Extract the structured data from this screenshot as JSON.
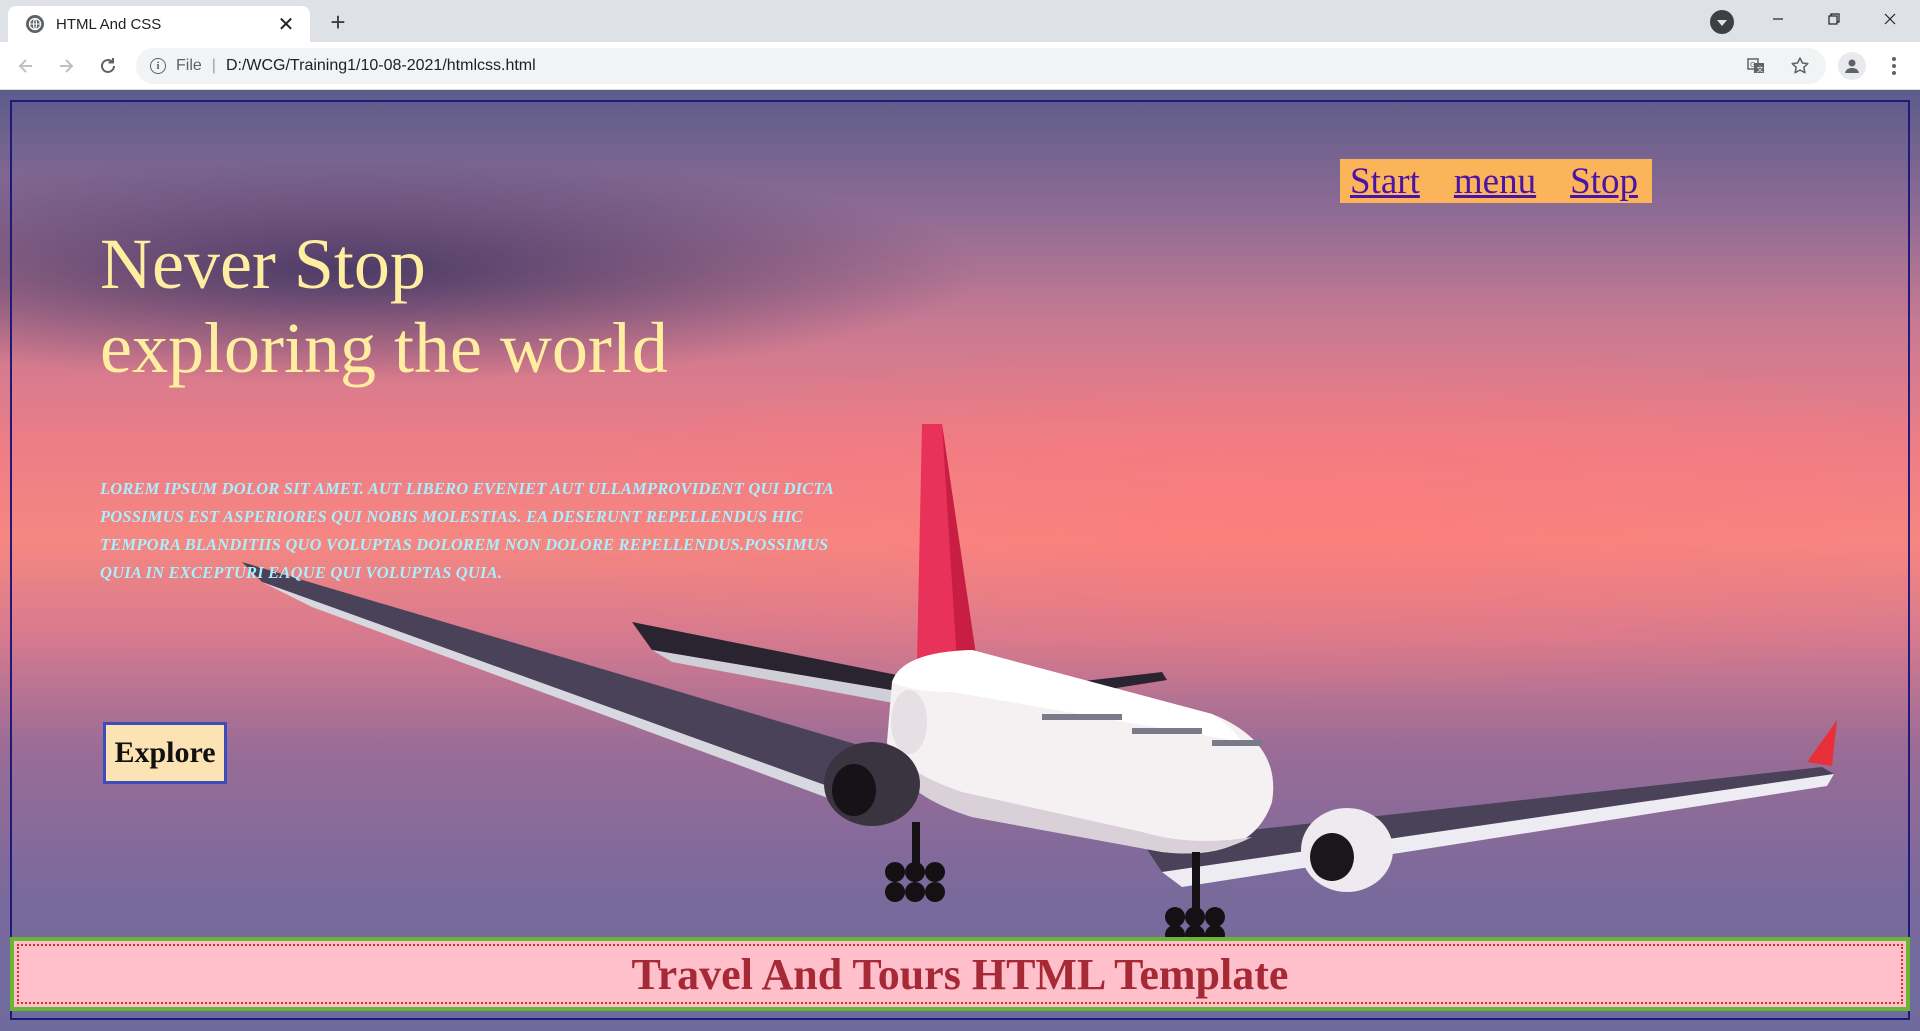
{
  "browser": {
    "tab_title": "HTML And CSS",
    "tab_close": "✕",
    "new_tab": "+",
    "url_scheme": "File",
    "url_separator": "|",
    "url": "D:/WCG/Training1/10-08-2021/htmlcss.html"
  },
  "nav": {
    "items": [
      "Start",
      "menu",
      "Stop"
    ]
  },
  "hero": {
    "headline_line1": "Never Stop",
    "headline_line2": "exploring the world",
    "body": "Lorem ipsum dolor sit amet. Aut libero eveniet aut ullamprovident qui dicta possimus est asperiores qui nobis molestias. Ea deserunt repellendus hic tempora blanditiis quo voluptas dolorem non dolore repellendus.Possimus quia in excepturi eaque qui voluptas quia.",
    "button_label": "Explore"
  },
  "footer": {
    "title": "Travel And Tours HTML Template"
  },
  "colors": {
    "headline": "#ffeea0",
    "body_text": "#a8f0ff",
    "nav_bg": "#fbb45a",
    "nav_link": "#4a14a8",
    "footer_bg": "#ffc0cb",
    "footer_text": "#a52a35",
    "footer_border": "#66b832",
    "hero_border": "#1f1a7a"
  }
}
